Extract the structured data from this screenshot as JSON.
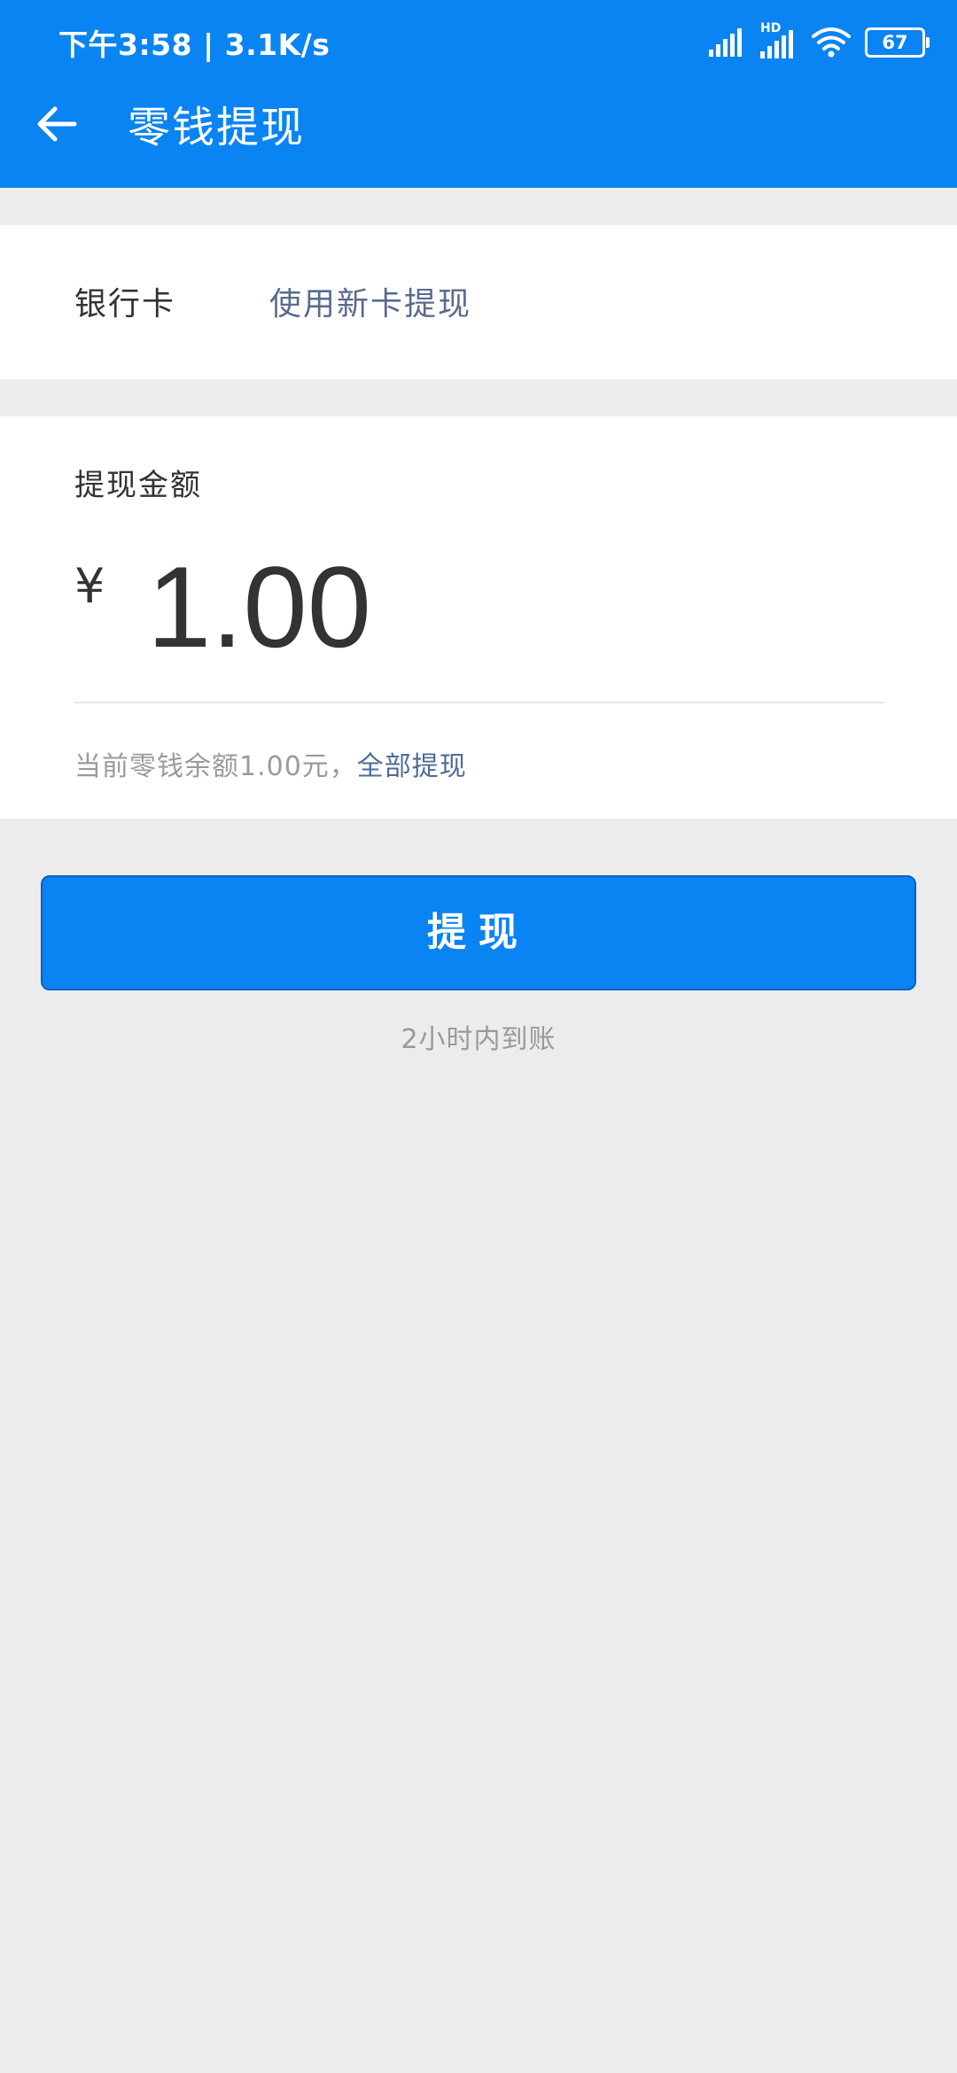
{
  "status_bar": {
    "time_speed": "下午3:58 | 3.1K/s",
    "battery": "67",
    "network_label": "HD",
    "icons": [
      "signal-icon",
      "signal-hd-icon",
      "wifi-icon",
      "battery-icon"
    ]
  },
  "header": {
    "title": "零钱提现",
    "back_icon": "back-arrow-icon"
  },
  "bank_card": {
    "label": "银行卡",
    "value": "使用新卡提现"
  },
  "amount": {
    "label": "提现金额",
    "currency": "¥",
    "value": "1.00",
    "balance_text": "当前零钱余额1.00元，",
    "withdraw_all": "全部提现"
  },
  "submit": {
    "label": "提现",
    "note": "2小时内到账"
  },
  "colors": {
    "primary": "#0a84f2",
    "link": "#4e6a99",
    "background": "#ececec"
  }
}
